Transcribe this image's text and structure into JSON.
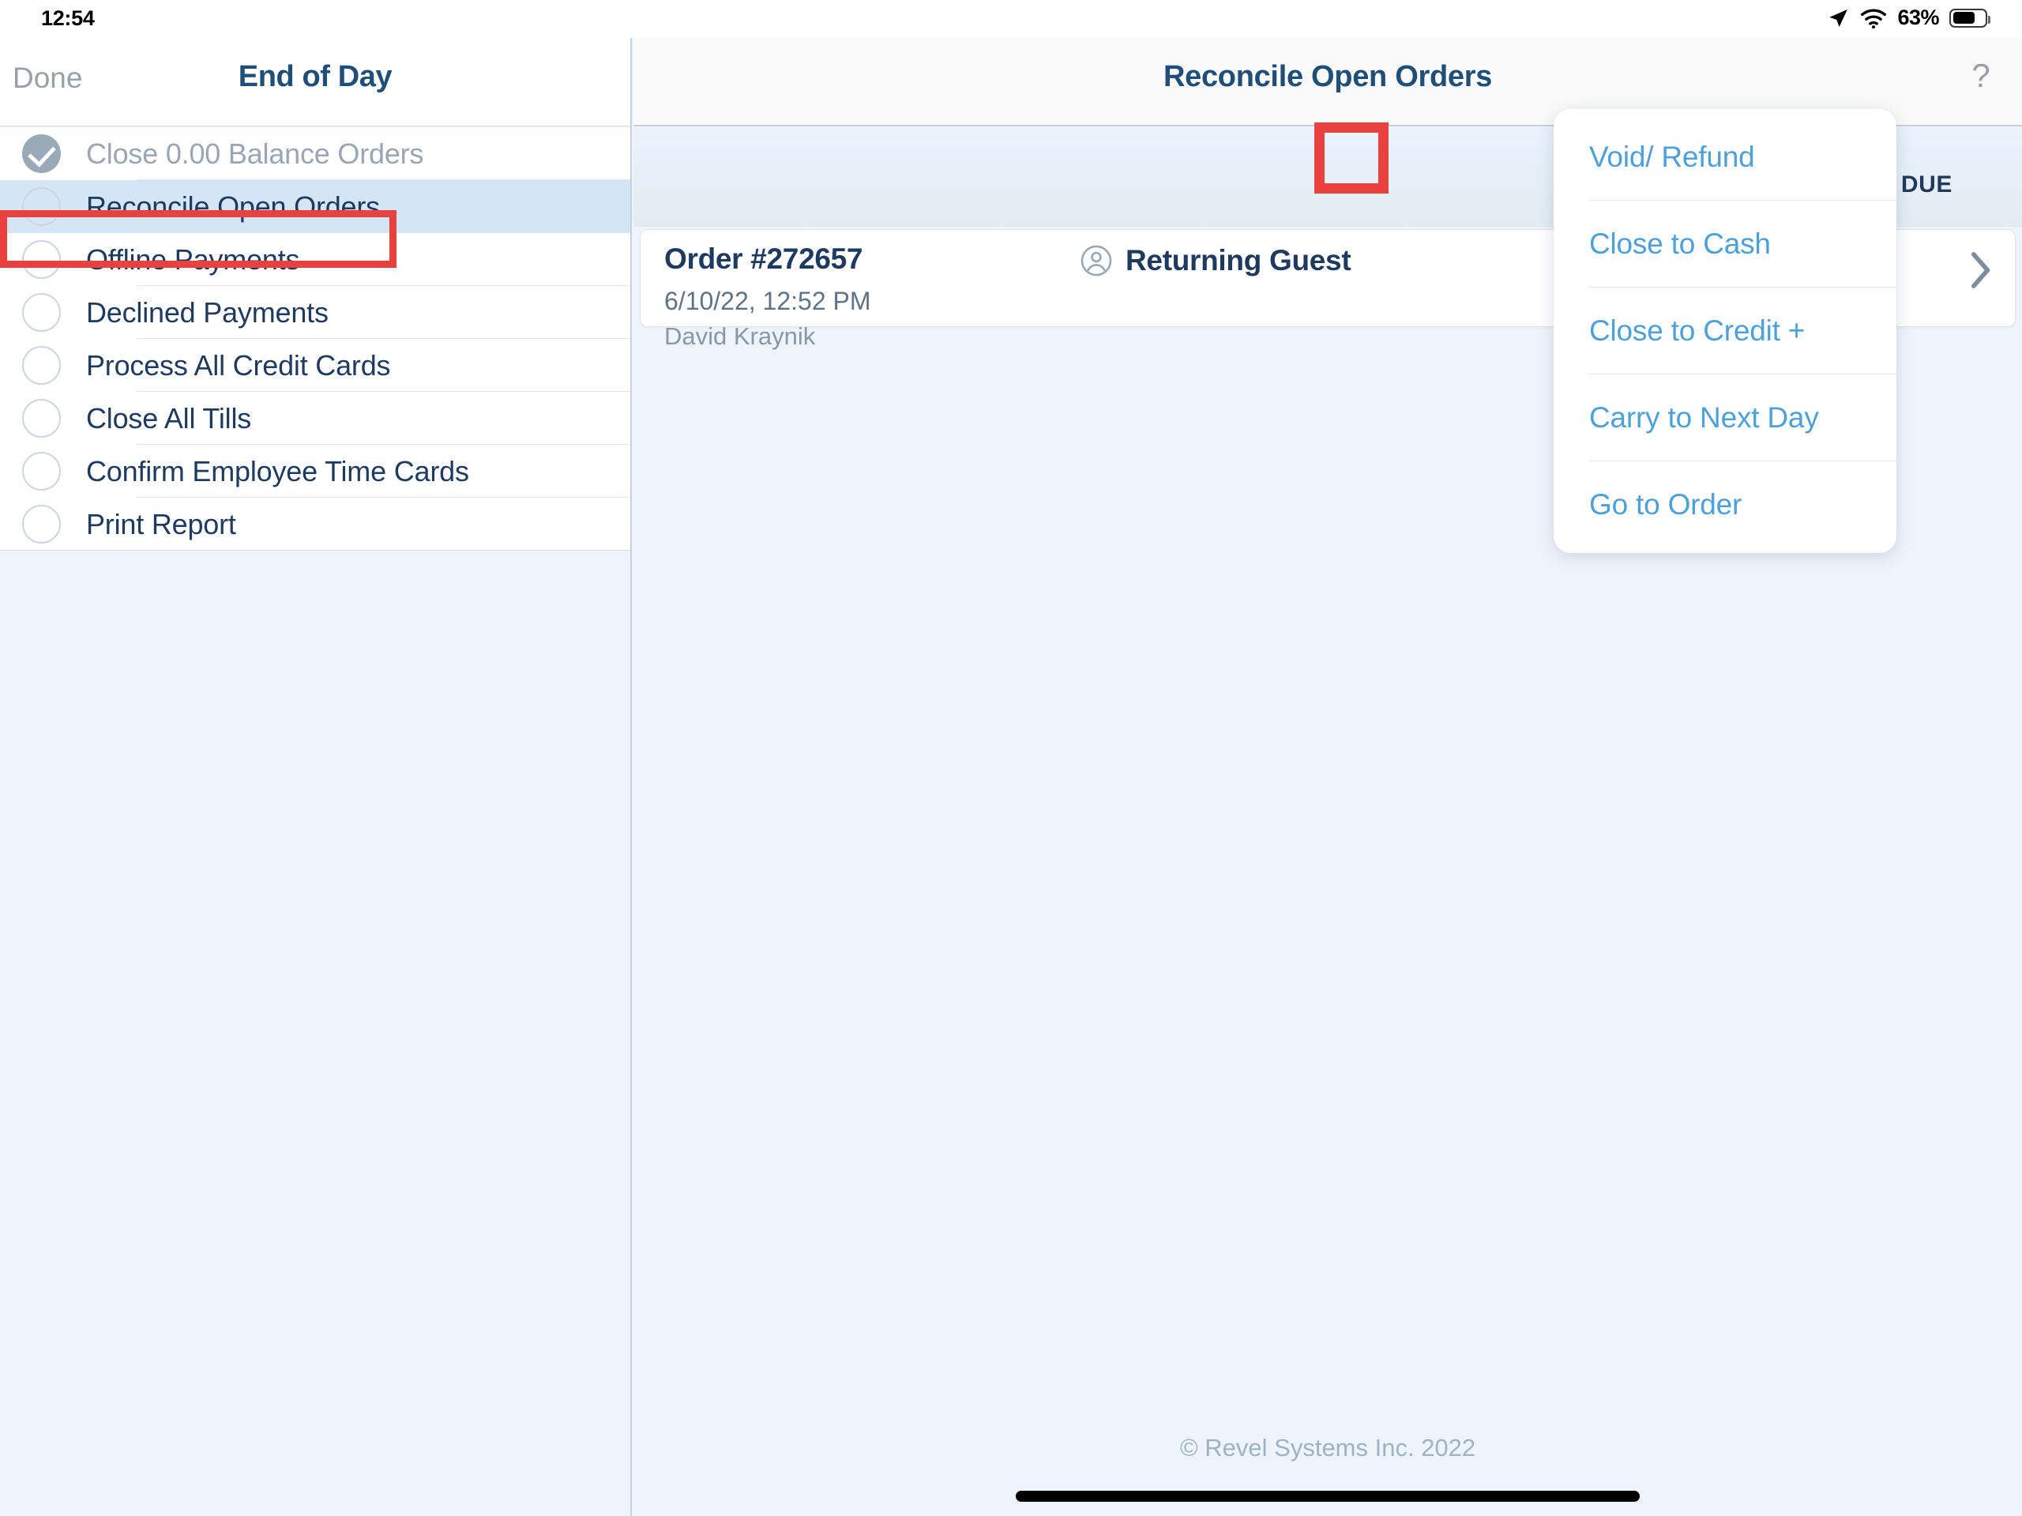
{
  "status_bar": {
    "time": "12:54",
    "battery_percent": "63%",
    "location_icon": "location-arrow-icon",
    "wifi_icon": "wifi-icon",
    "battery_icon": "battery-icon"
  },
  "sidebar": {
    "done_label": "Done",
    "title": "End of Day",
    "items": [
      {
        "label": "Close 0.00 Balance Orders",
        "state": "done"
      },
      {
        "label": "Reconcile Open Orders",
        "state": "selected"
      },
      {
        "label": "Offline Payments",
        "state": "pending"
      },
      {
        "label": "Declined Payments",
        "state": "pending"
      },
      {
        "label": "Process All Credit Cards",
        "state": "pending"
      },
      {
        "label": "Close All Tills",
        "state": "pending"
      },
      {
        "label": "Confirm Employee Time Cards",
        "state": "pending"
      },
      {
        "label": "Print Report",
        "state": "pending"
      }
    ]
  },
  "main": {
    "title": "Reconcile Open Orders",
    "help_label": "?",
    "column_header_balance_due": "BALANCE DUE",
    "order": {
      "number": "Order #272657",
      "datetime": "6/10/22, 12:52 PM",
      "employee": "David Kraynik",
      "guest_label": "Returning Guest",
      "guest_icon": "person-circle-icon",
      "chevron_icon": "chevron-right-icon"
    }
  },
  "popup_menu": {
    "items": [
      {
        "label": "Void/ Refund"
      },
      {
        "label": "Close to Cash"
      },
      {
        "label": "Close to Credit +"
      },
      {
        "label": "Carry to Next Day"
      },
      {
        "label": "Go to Order"
      }
    ]
  },
  "footer": {
    "copyright": "© Revel Systems Inc. 2022"
  },
  "colors": {
    "annotation_red": "#e8413f",
    "accent_blue": "#4da0d8",
    "title_navy": "#1f4e79",
    "page_bg": "#eef4fb",
    "selected_row": "#d4e6f5"
  }
}
